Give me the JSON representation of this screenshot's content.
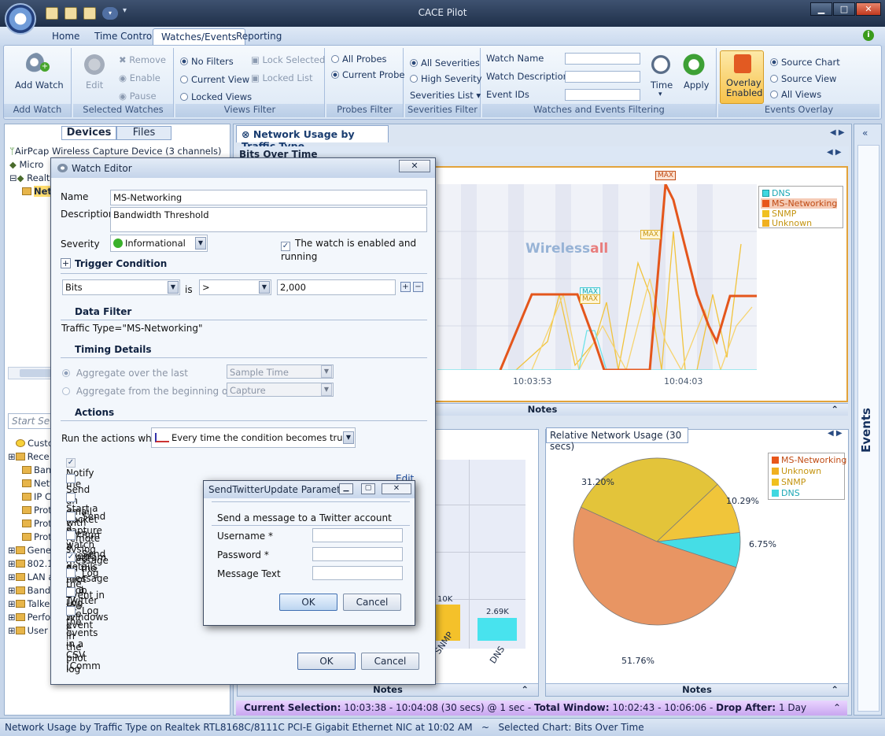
{
  "window": {
    "title": "CACE Pilot"
  },
  "ribbon_tabs": [
    "Home",
    "Time Control",
    "Watches/Events",
    "Reporting"
  ],
  "ribbon": {
    "add_watch": "Add Watch",
    "add_watch_group": "Add Watch",
    "edit": "Edit",
    "remove": "Remove",
    "enable": "Enable",
    "pause": "Pause",
    "selected_watches": "Selected Watches",
    "no_filters": "No Filters",
    "current_view": "Current View",
    "locked_views": "Locked Views",
    "lock_selected": "Lock Selected",
    "locked_list": "Locked List",
    "views_filter": "Views Filter",
    "all_probes": "All Probes",
    "current_probe": "Current Probe",
    "probes_filter": "Probes Filter",
    "all_severities": "All Severities",
    "high_severity": "High Severity",
    "severities_list": "Severities List",
    "severities_filter": "Severities Filter",
    "watch_name": "Watch Name",
    "watch_description": "Watch Description",
    "event_ids": "Event IDs",
    "time": "Time",
    "apply": "Apply",
    "watches_filtering": "Watches and Events Filtering",
    "overlay": "Overlay",
    "overlay_enabled": "Enabled",
    "source_chart": "Source Chart",
    "source_view": "Source View",
    "all_views": "All Views",
    "events_overlay": "Events Overlay"
  },
  "left": {
    "tabs": [
      "Devices",
      "Files"
    ],
    "devices": [
      "AirPcap Wireless Capture Device (3 channels)",
      "Micro",
      "Realt",
      "Netw"
    ],
    "search_placeholder": "Start Se",
    "views": [
      "Custo",
      "Rece",
      "Band",
      "Netw",
      "IP Co",
      "Proto",
      "Proto",
      "Proto",
      "Gene",
      "802.1",
      "LAN a",
      "Band",
      "Talke",
      "Perfo",
      "User"
    ]
  },
  "view": {
    "tab": "Network Usage by Traffic Type",
    "bits_title": "Bits Over Time",
    "notes": "Notes",
    "relative_title": "Relative Network Usage (30 secs)",
    "selection_label": "Current Selection:",
    "selection_value": "10:03:38 - 10:04:08 (30 secs) @ 1 sec",
    "total_label": "Total Window:",
    "total_value": "10:02:43 - 10:06:06",
    "drop_label": "Drop After:",
    "drop_value": "1 Day",
    "events": "Events",
    "watermark_a": "Wireless",
    "watermark_b": "all"
  },
  "chart_data": [
    {
      "type": "line",
      "title": "Bits Over Time",
      "x_ticks": [
        "10:03:53",
        "10:04:03"
      ],
      "legend": [
        "DNS",
        "MS-Networking",
        "SNMP",
        "Unknown"
      ],
      "colors": {
        "DNS": "#40d8e0",
        "MS-Networking": "#e8561a",
        "SNMP": "#f0c020",
        "Unknown": "#f0b020"
      },
      "annotations": [
        "MAX",
        "MAX",
        "MAX",
        "MAX"
      ]
    },
    {
      "type": "bar",
      "categories": [
        "SNMP",
        "DNS"
      ],
      "data_labels": [
        "10K",
        "2.69K"
      ]
    },
    {
      "type": "pie",
      "title": "Relative Network Usage (30 secs)",
      "slices": [
        {
          "name": "MS-Networking",
          "label": "51.76%",
          "value": 51.76,
          "color": "#e89563"
        },
        {
          "name": "Unknown",
          "label": "31.20%",
          "value": 31.2,
          "color": "#e3c43a"
        },
        {
          "name": "SNMP",
          "label": "10.29%",
          "value": 10.29,
          "color": "#f0c53a"
        },
        {
          "name": "DNS",
          "label": "6.75%",
          "value": 6.75,
          "color": "#45dde6"
        }
      ]
    }
  ],
  "watch_editor": {
    "title": "Watch Editor",
    "name_label": "Name",
    "name_value": "MS-Networking",
    "desc_label": "Description",
    "desc_value": "Bandwidth Threshold",
    "severity_label": "Severity",
    "severity_value": "Informational",
    "enabled_label": "The watch is enabled and running",
    "trigger": "Trigger Condition",
    "field": "Bits",
    "is": "is",
    "op": ">",
    "threshold": "2,000",
    "data_filter": "Data Filter",
    "filter_value": "Traffic Type=\"MS-Networking\"",
    "timing": "Timing Details",
    "agg_last": "Aggregate over the last",
    "agg_begin": "Aggregate from the beginning of every",
    "sample": "Sample Time",
    "capture": "Capture",
    "actions": "Actions",
    "run_label": "Run the actions when",
    "run_value": "Every time the condition becomes true",
    "action_list": [
      "Notify me",
      "Send an email with the watch event details",
      "Start a packet capture",
      "Send a remote syslog message",
      "Run a program on the Pilot Prob",
      "Send a message to a Twitter ac",
      "Log the event in the Windows e",
      "Log the event in the pilot log",
      "Log the events in a CSV (Comm"
    ],
    "edit": "Edit",
    "ok": "OK",
    "cancel": "Cancel"
  },
  "twitter": {
    "title": "SendTwitterUpdate Paramet...",
    "heading": "Send a message to a Twitter account",
    "username": "Username *",
    "password": "Password *",
    "message": "Message Text",
    "ok": "OK",
    "cancel": "Cancel"
  },
  "status": {
    "left": "Network Usage by Traffic Type on Realtek RTL8168C/8111C PCI-E Gigabit Ethernet NIC at 10:02 AM",
    "sep": "~",
    "right": "Selected Chart: Bits Over Time"
  }
}
